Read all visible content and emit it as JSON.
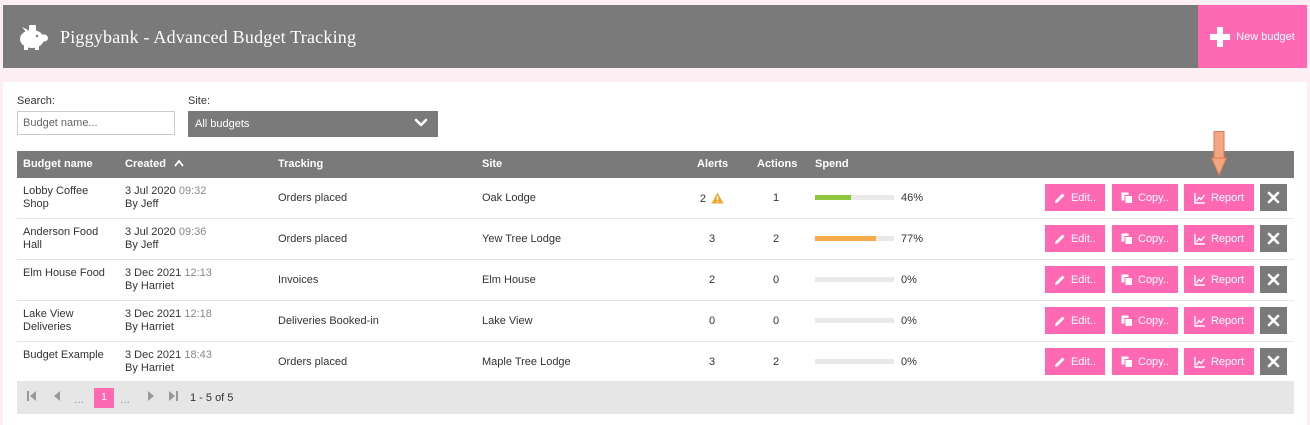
{
  "header": {
    "app_title": "Piggybank - Advanced Budget Tracking",
    "new_budget_label": "New budget"
  },
  "filters": {
    "search_label": "Search:",
    "search_placeholder": "Budget name...",
    "site_label": "Site:",
    "site_selected": "All budgets"
  },
  "table": {
    "columns": [
      "Budget name",
      "Created",
      "Tracking",
      "Site",
      "Alerts",
      "Actions",
      "Spend"
    ],
    "sorted_column": "Created",
    "sort_direction": "ascending",
    "rows": [
      {
        "name": "Lobby Coffee Shop",
        "created_date": "3 Jul 2020",
        "created_time": "09:32",
        "created_by": "By Jeff",
        "tracking": "Orders placed",
        "site": "Oak Lodge",
        "alerts": "2",
        "alert_warning": true,
        "actions": "1",
        "spend_label": "46%",
        "spend_fraction": 0.46,
        "spend_color": "#8cc63f"
      },
      {
        "name": "Anderson Food Hall",
        "created_date": "3 Jul 2020",
        "created_time": "09:36",
        "created_by": "By Jeff",
        "tracking": "Orders placed",
        "site": "Yew Tree Lodge",
        "alerts": "3",
        "alert_warning": false,
        "actions": "2",
        "spend_label": "77%",
        "spend_fraction": 0.77,
        "spend_color": "#f7a94b"
      },
      {
        "name": "Elm House Food",
        "created_date": "3 Dec 2021",
        "created_time": "12:13",
        "created_by": "By Harriet",
        "tracking": "Invoices",
        "site": "Elm House",
        "alerts": "2",
        "alert_warning": false,
        "actions": "0",
        "spend_label": "0%",
        "spend_fraction": 0,
        "spend_color": "#8cc63f"
      },
      {
        "name": "Lake View Deliveries",
        "created_date": "3 Dec 2021",
        "created_time": "12:18",
        "created_by": "By Harriet",
        "tracking": "Deliveries Booked-in",
        "site": "Lake View",
        "alerts": "0",
        "alert_warning": false,
        "actions": "0",
        "spend_label": "0%",
        "spend_fraction": 0,
        "spend_color": "#8cc63f"
      },
      {
        "name": "Budget Example",
        "created_date": "3 Dec 2021",
        "created_time": "18:43",
        "created_by": "By Harriet",
        "tracking": "Orders placed",
        "site": "Maple Tree Lodge",
        "alerts": "3",
        "alert_warning": false,
        "actions": "2",
        "spend_label": "0%",
        "spend_fraction": 0,
        "spend_color": "#8cc63f"
      }
    ],
    "row_buttons": {
      "edit_label": "Edit..",
      "copy_label": "Copy..",
      "report_label": "Report"
    }
  },
  "pagination": {
    "current_page": "1",
    "ellipsis": "...",
    "range_text": "1 - 5 of 5"
  },
  "colors": {
    "header_gray": "#7a7a7a",
    "accent_pink": "#ff69b4",
    "page_background": "#fdeef4",
    "warning_amber": "#f0a830",
    "annotation_arrow": "#f4a582"
  },
  "icons": {
    "logo": "piggy-bank-icon",
    "new_budget": "plus-icon",
    "site_select": "chevron-down-icon",
    "sort": "sort-up-icon",
    "alert": "warning-icon",
    "edit": "pencil-icon",
    "copy": "copy-icon",
    "report": "chart-line-icon",
    "delete": "close-icon"
  }
}
